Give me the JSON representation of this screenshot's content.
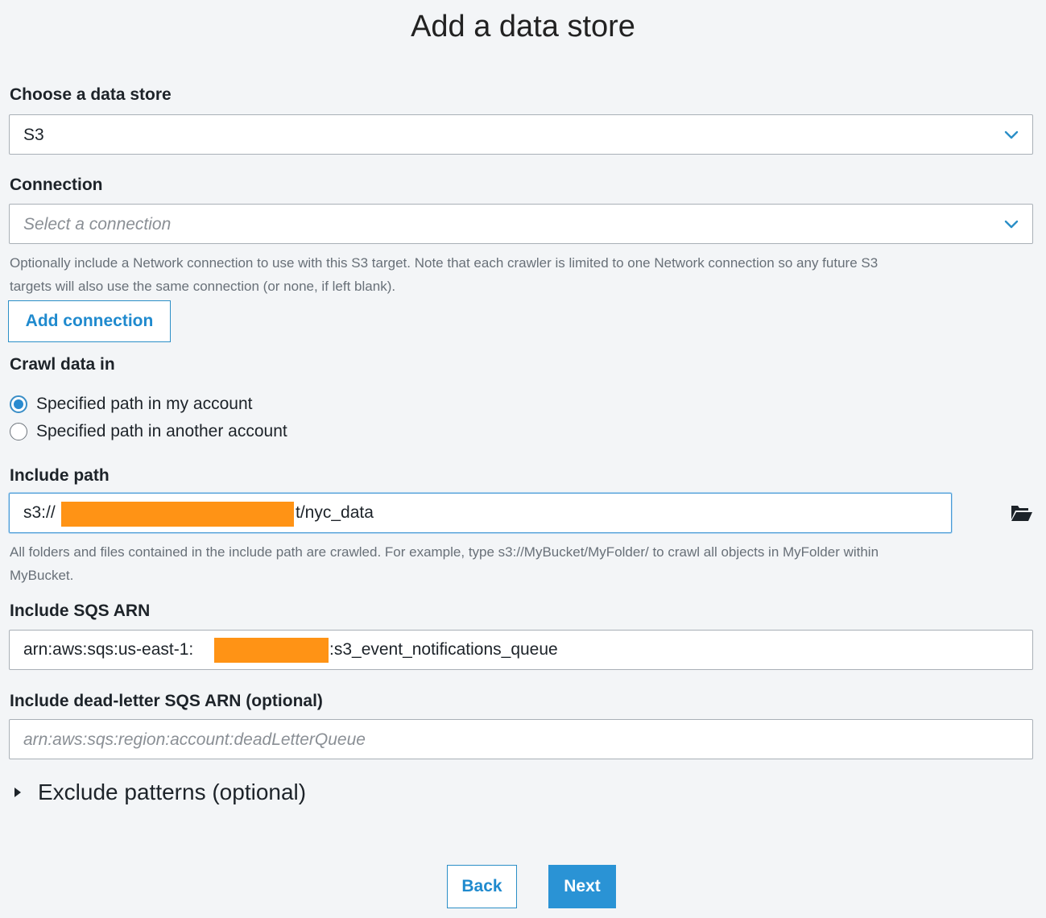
{
  "header": {
    "title": "Add a data store"
  },
  "data_store": {
    "label": "Choose a data store",
    "selected": "S3"
  },
  "connection": {
    "label": "Connection",
    "placeholder": "Select a connection",
    "help_line1": "Optionally include a Network connection to use with this S3 target. Note that each crawler is limited to one Network connection so any future S3",
    "help_line2": "targets will also use the same connection (or none, if left blank).",
    "add_button": "Add connection"
  },
  "crawl": {
    "label": "Crawl data in",
    "options": [
      {
        "label": "Specified path in my account",
        "checked": true
      },
      {
        "label": "Specified path in another account",
        "checked": false
      }
    ]
  },
  "include_path": {
    "label": "Include path",
    "value_prefix": "s3://",
    "value_suffix": "t/nyc_data",
    "help_line1": "All folders and files contained in the include path are crawled. For example, type s3://MyBucket/MyFolder/ to crawl all objects in MyFolder within",
    "help_line2": "MyBucket."
  },
  "sqs": {
    "label": "Include SQS ARN",
    "value_prefix": "arn:aws:sqs:us-east-1:",
    "value_suffix": ":s3_event_notifications_queue"
  },
  "dead_letter": {
    "label": "Include dead-letter SQS ARN (optional)",
    "placeholder": "arn:aws:sqs:region:account:deadLetterQueue"
  },
  "exclude": {
    "label": "Exclude patterns (optional)"
  },
  "footer": {
    "back_label": "Back",
    "next_label": "Next"
  },
  "colors": {
    "accent": "#2a93d5",
    "redaction": "#ff9315",
    "background": "#f3f5f7"
  },
  "icons": {
    "select_chevron": "chevron-down-icon",
    "browse": "folder-open-icon",
    "expander": "caret-right-icon"
  }
}
